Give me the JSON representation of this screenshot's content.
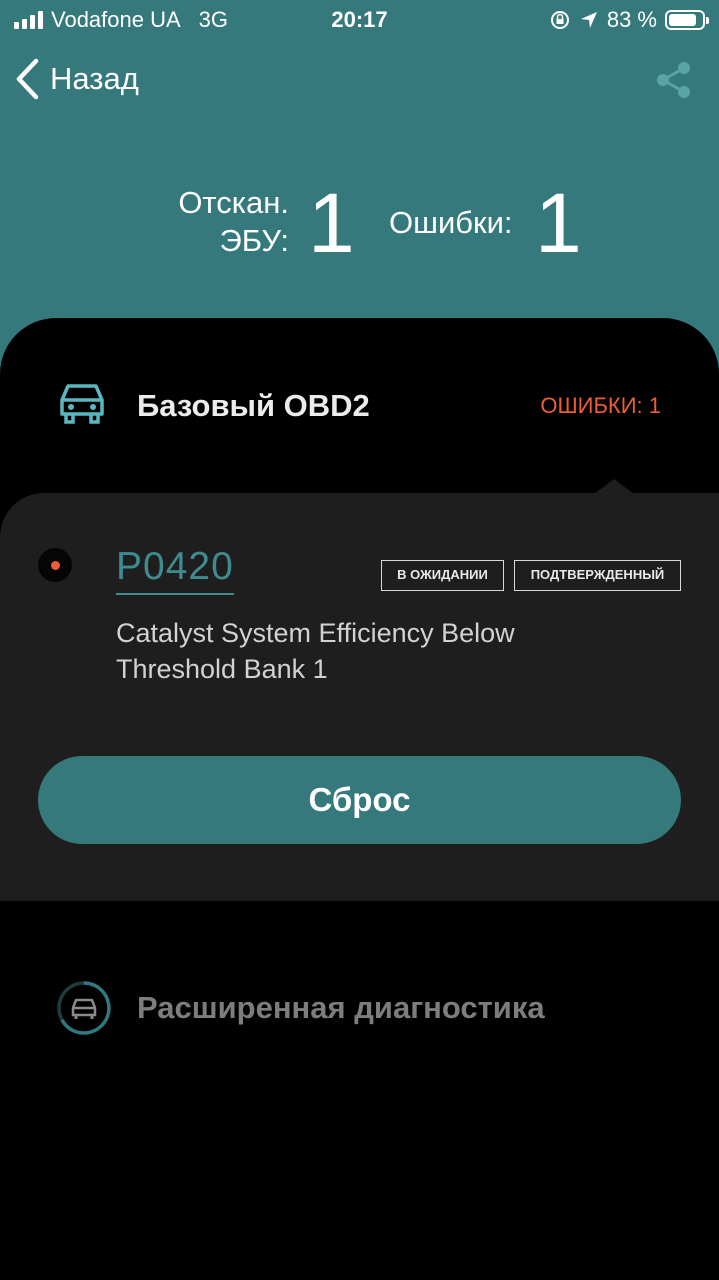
{
  "status_bar": {
    "carrier": "Vodafone UA",
    "network": "3G",
    "time": "20:17",
    "battery_percent": "83 %",
    "battery_level": 0.83,
    "signal_bars": 4
  },
  "nav": {
    "back_label": "Назад",
    "back_icon": "chevron-left-icon",
    "share_icon": "share-icon"
  },
  "summary": {
    "scanned_label_line1": "Отскан.",
    "scanned_label_line2": "ЭБУ:",
    "scanned_value": "1",
    "errors_label": "Ошибки:",
    "errors_value": "1"
  },
  "obd": {
    "icon": "car-icon",
    "title": "Базовый OBD2",
    "errors_badge": "ОШИБКИ: 1",
    "dtc": {
      "code": "P0420",
      "tags": [
        "В ОЖИДАНИИ",
        "ПОДТВЕРЖДЕННЫЙ"
      ],
      "description": "Catalyst System Efficiency Below Threshold Bank 1"
    },
    "reset_label": "Сброс"
  },
  "advanced": {
    "icon": "car-progress-icon",
    "title": "Расширенная диагностика"
  },
  "colors": {
    "accent_teal": "#35797c",
    "link_teal": "#3e8c90",
    "error_orange": "#ee5d37",
    "card_bg": "#1e1e1e"
  }
}
